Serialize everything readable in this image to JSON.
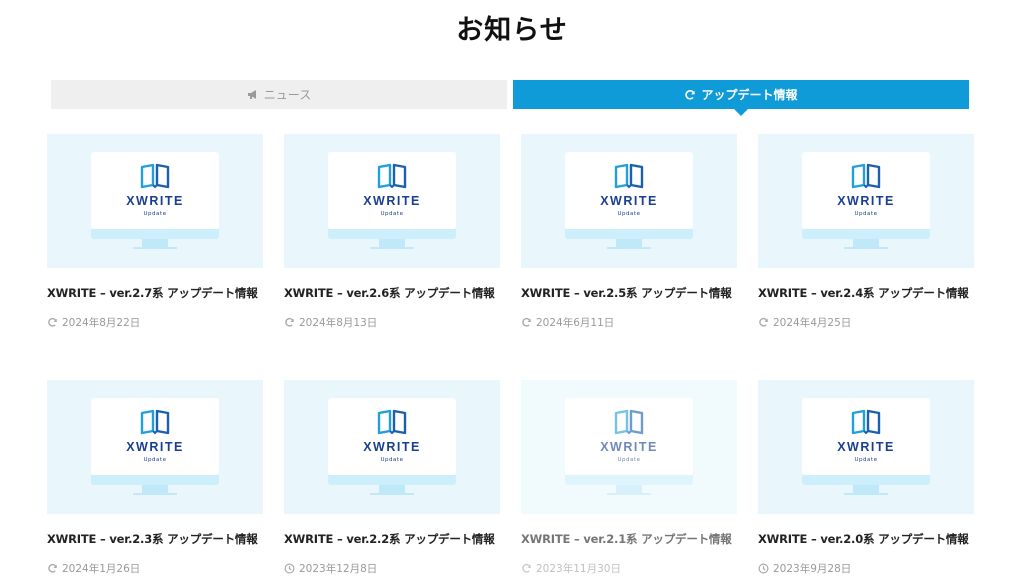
{
  "page": {
    "title": "お知らせ"
  },
  "tabs": [
    {
      "label": "ニュース",
      "icon": "megaphone-icon",
      "active": false
    },
    {
      "label": "アップデート情報",
      "icon": "refresh-icon",
      "active": true
    }
  ],
  "thumbnail": {
    "brand": "XWRITE",
    "subtitle": "Update",
    "icon": "book-icon"
  },
  "colors": {
    "accent": "#0f9bd7",
    "brand": "#1b3f8f",
    "thumb_bg": "#e9f7fd",
    "muted": "#999999"
  },
  "posts": [
    {
      "title": "XWRITE – ver.2.7系 アップデート情報",
      "date": "2024年8月22日",
      "date_icon": "refresh-icon"
    },
    {
      "title": "XWRITE – ver.2.6系 アップデート情報",
      "date": "2024年8月13日",
      "date_icon": "refresh-icon"
    },
    {
      "title": "XWRITE – ver.2.5系 アップデート情報",
      "date": "2024年6月11日",
      "date_icon": "refresh-icon"
    },
    {
      "title": "XWRITE – ver.2.4系 アップデート情報",
      "date": "2024年4月25日",
      "date_icon": "refresh-icon"
    },
    {
      "title": "XWRITE – ver.2.3系 アップデート情報",
      "date": "2024年1月26日",
      "date_icon": "refresh-icon"
    },
    {
      "title": "XWRITE – ver.2.2系 アップデート情報",
      "date": "2023年12月8日",
      "date_icon": "clock-icon"
    },
    {
      "title": "XWRITE – ver.2.1系 アップデート情報",
      "date": "2023年11月30日",
      "date_icon": "refresh-icon"
    },
    {
      "title": "XWRITE – ver.2.0系 アップデート情報",
      "date": "2023年9月28日",
      "date_icon": "clock-icon"
    }
  ]
}
